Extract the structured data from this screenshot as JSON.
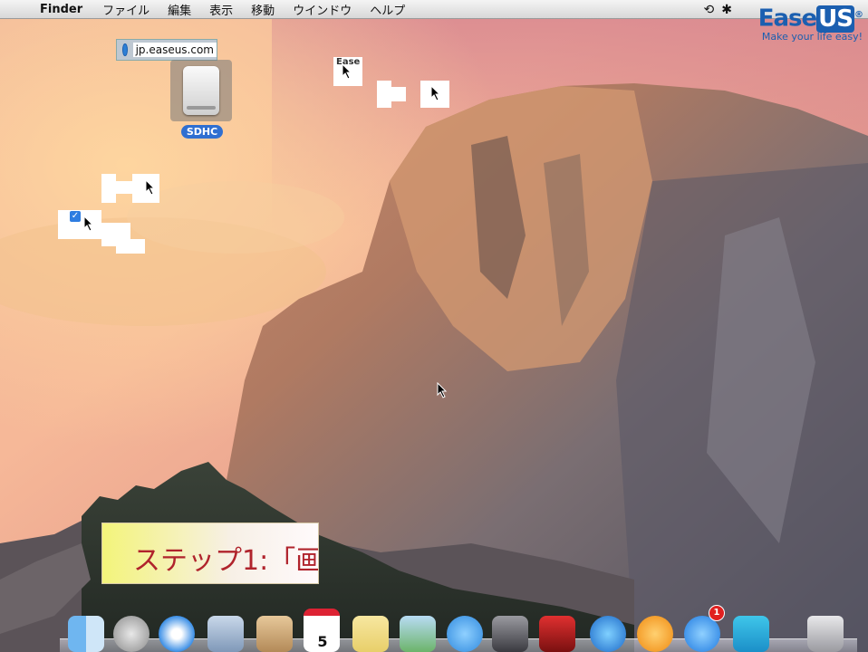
{
  "menubar": {
    "app_name": "Finder",
    "menus": [
      "ファイル",
      "編集",
      "表示",
      "移動",
      "ウインドウ",
      "ヘルプ"
    ]
  },
  "watermark": {
    "brand": "Ease",
    "brand_suffix": "US",
    "registered": "®",
    "tagline": "Make your life easy!"
  },
  "url_chip": {
    "url": "jp.easeus.com"
  },
  "desktop_drive": {
    "label": "SDHC"
  },
  "fragments": {
    "text_ease": "Ease"
  },
  "step_banner": {
    "text": "ステップ1:「画"
  },
  "dock": {
    "calendar_day": "5",
    "app_store_badge": "1"
  },
  "colors": {
    "accent": "#1b5fb0",
    "banner_text": "#b0232c",
    "badge": "#e02020"
  }
}
